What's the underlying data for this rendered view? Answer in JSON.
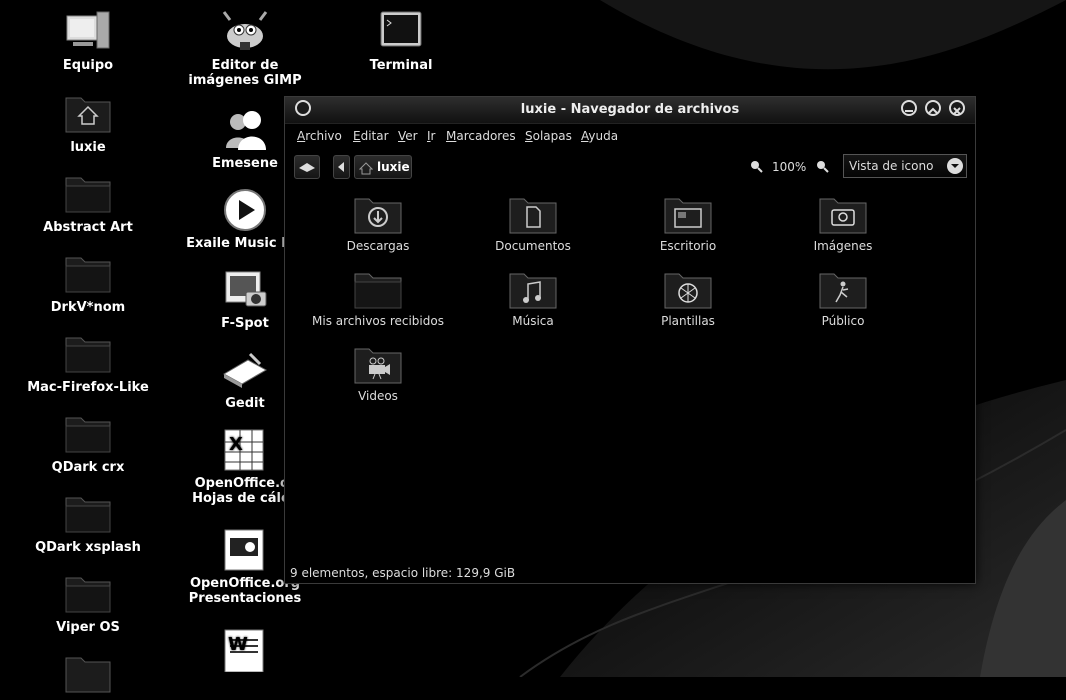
{
  "desktop": {
    "left_column": [
      {
        "label": "Equipo",
        "icon": "computer-icon"
      },
      {
        "label": "luxie",
        "icon": "home-folder-icon"
      },
      {
        "label": "Abstract Art",
        "icon": "folder-icon"
      },
      {
        "label": "DrkV*nom",
        "icon": "folder-icon"
      },
      {
        "label": "Mac-Firefox-Like",
        "icon": "folder-icon"
      },
      {
        "label": "QDark crx",
        "icon": "folder-icon"
      },
      {
        "label": "QDark xsplash",
        "icon": "folder-icon"
      },
      {
        "label": "Viper OS",
        "icon": "folder-icon"
      }
    ],
    "mid_column": [
      {
        "line1": "Editor de",
        "line2": "imágenes GIMP",
        "icon": "gimp-icon"
      },
      {
        "line1": "Emesene",
        "line2": "",
        "icon": "emesene-icon"
      },
      {
        "line1": "Exaile Music Pla",
        "line2": "",
        "icon": "exaile-icon"
      },
      {
        "line1": "F-Spot",
        "line2": "",
        "icon": "fspot-icon"
      },
      {
        "line1": "Gedit",
        "line2": "",
        "icon": "gedit-icon"
      },
      {
        "line1": "OpenOffice.or",
        "line2": "Hojas de cálcu",
        "icon": "spreadsheet-icon"
      },
      {
        "line1": "OpenOffice.org",
        "line2": "Presentaciones",
        "icon": "presentation-icon"
      }
    ],
    "terminal": {
      "label": "Terminal",
      "icon": "terminal-icon"
    }
  },
  "window": {
    "title": "luxie - Navegador de archivos",
    "menu": [
      "Archivo",
      "Editar",
      "Ver",
      "Ir",
      "Marcadores",
      "Solapas",
      "Ayuda"
    ],
    "breadcrumb": "luxie",
    "zoom": "100%",
    "view_mode": "Vista de icono",
    "items": [
      {
        "label": "Descargas",
        "icon": "download-folder-icon"
      },
      {
        "label": "Documentos",
        "icon": "documents-folder-icon"
      },
      {
        "label": "Escritorio",
        "icon": "desktop-folder-icon"
      },
      {
        "label": "Imágenes",
        "icon": "pictures-folder-icon"
      },
      {
        "label": "Mis archivos recibidos",
        "icon": "folder-icon"
      },
      {
        "label": "Música",
        "icon": "music-folder-icon"
      },
      {
        "label": "Plantillas",
        "icon": "templates-folder-icon"
      },
      {
        "label": "Público",
        "icon": "public-folder-icon"
      },
      {
        "label": "Videos",
        "icon": "videos-folder-icon"
      }
    ],
    "status": "9 elementos, espacio libre: 129,9 GiB"
  }
}
